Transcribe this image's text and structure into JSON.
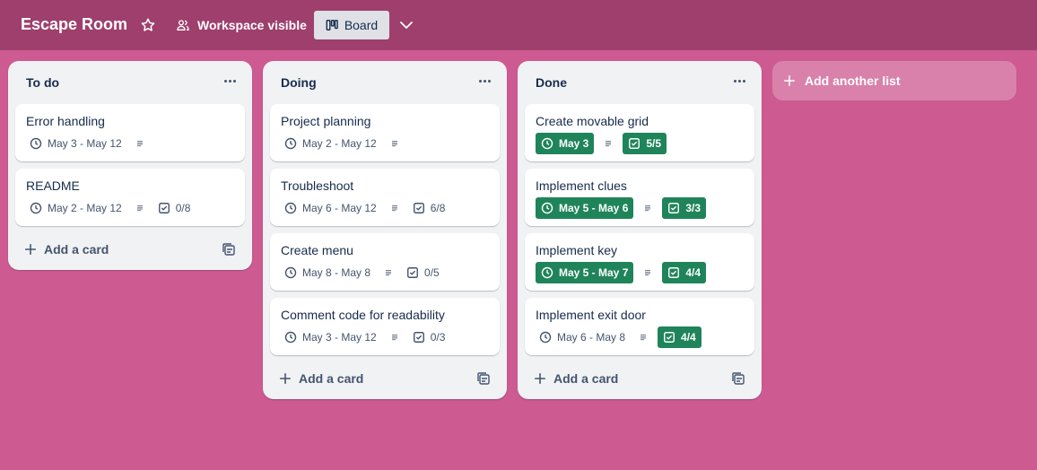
{
  "header": {
    "title": "Escape Room",
    "visibility_label": "Workspace visible",
    "view_label": "Board"
  },
  "colors": {
    "background": "#cd5a91",
    "header": "#9e3f6d",
    "done_badge": "#1f845a"
  },
  "lists": [
    {
      "title": "To do",
      "add_card_label": "Add a card",
      "cards": [
        {
          "title": "Error handling",
          "dates": "May 3 - May 12",
          "checklist": ""
        },
        {
          "title": "README",
          "dates": "May 2 - May 12",
          "checklist": "0/8"
        }
      ]
    },
    {
      "title": "Doing",
      "add_card_label": "Add a card",
      "cards": [
        {
          "title": "Project planning",
          "dates": "May 2 - May 12",
          "checklist": ""
        },
        {
          "title": "Troubleshoot",
          "dates": "May 6 - May 12",
          "checklist": "6/8"
        },
        {
          "title": "Create menu",
          "dates": "May 8 - May 8",
          "checklist": "0/5"
        },
        {
          "title": "Comment code for readability",
          "dates": "May 3 - May 12",
          "checklist": "0/3"
        }
      ]
    },
    {
      "title": "Done",
      "add_card_label": "Add a card",
      "cards": [
        {
          "title": "Create movable grid",
          "dates": "May 3",
          "checklist": "5/5"
        },
        {
          "title": "Implement clues",
          "dates": "May 5 - May 6",
          "checklist": "3/3"
        },
        {
          "title": "Implement key",
          "dates": "May 5 - May 7",
          "checklist": "4/4"
        },
        {
          "title": "Implement exit door",
          "dates": "May 6 - May 8",
          "checklist": "4/4"
        }
      ]
    }
  ],
  "add_list_label": "Add another list"
}
